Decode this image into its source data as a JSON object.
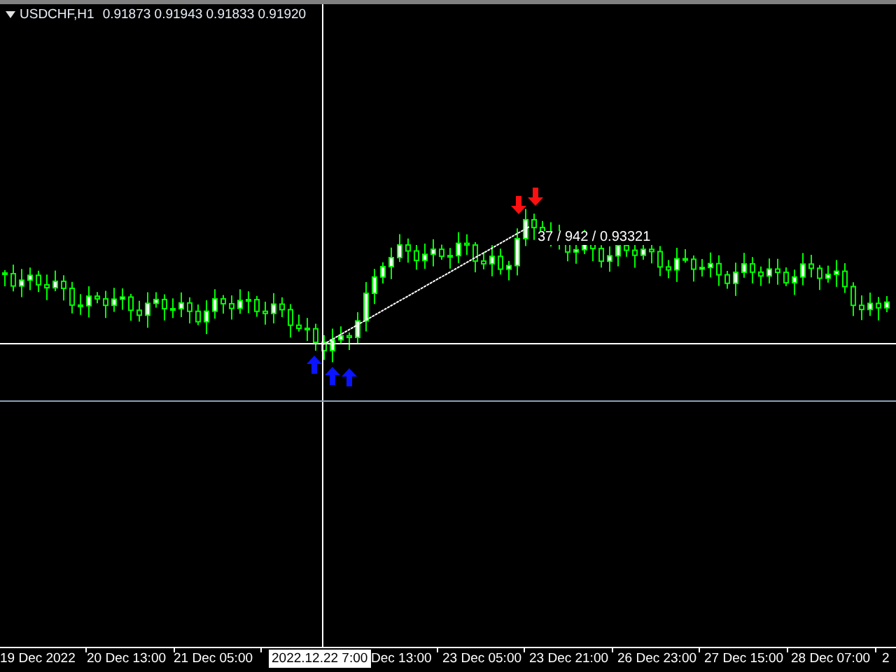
{
  "chart_header": {
    "symbol": "USDCHF,H1",
    "prices": "0.91873 0.91943 0.91833 0.91920"
  },
  "measure_label": "37 / 942 / 0.93321",
  "crosshair_time": "2022.12.22 7:00",
  "time_axis": [
    {
      "label": "19 Dec 2022"
    },
    {
      "label": "20 Dec 13:00"
    },
    {
      "label": "21 Dec 05:00"
    },
    {
      "label": "Dec 13:00"
    },
    {
      "label": "23 Dec 05:00"
    },
    {
      "label": "23 Dec 21:00"
    },
    {
      "label": "26 Dec 23:00"
    },
    {
      "label": "27 Dec 15:00"
    },
    {
      "label": "28 Dec 07:00"
    },
    {
      "label": "2"
    }
  ]
}
